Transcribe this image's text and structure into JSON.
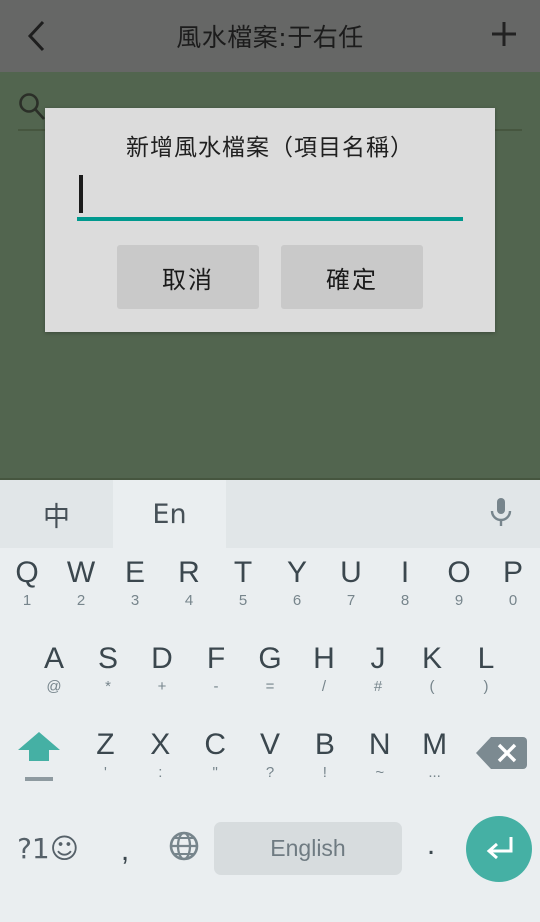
{
  "app": {
    "title": "風水檔案:于右任",
    "back_icon": "chevron-left-icon",
    "add_icon": "plus-icon",
    "search_icon": "search-icon",
    "appbar_color": "#666766",
    "content_color": "#52654f"
  },
  "dialog": {
    "title": "新增風水檔案（項目名稱）",
    "input_value": "",
    "input_placeholder": "",
    "underline_color": "#00998e",
    "background_color": "#dcdcdc",
    "buttons": [
      {
        "label": "取消",
        "name": "cancel-button"
      },
      {
        "label": "確定",
        "name": "confirm-button"
      }
    ]
  },
  "keyboard": {
    "accent_color": "#45b0a4",
    "background_color": "#eaeef0",
    "toolbar": {
      "tabs": [
        {
          "label": "中",
          "active": false
        },
        {
          "label": "En",
          "active": true
        }
      ],
      "mic_icon": "microphone-icon"
    },
    "row1": [
      {
        "main": "Q",
        "alt": "1"
      },
      {
        "main": "W",
        "alt": "2"
      },
      {
        "main": "E",
        "alt": "3"
      },
      {
        "main": "R",
        "alt": "4"
      },
      {
        "main": "T",
        "alt": "5"
      },
      {
        "main": "Y",
        "alt": "6"
      },
      {
        "main": "U",
        "alt": "7"
      },
      {
        "main": "I",
        "alt": "8"
      },
      {
        "main": "O",
        "alt": "9"
      },
      {
        "main": "P",
        "alt": "0"
      }
    ],
    "row2": [
      {
        "main": "A",
        "alt": "@"
      },
      {
        "main": "S",
        "alt": "*"
      },
      {
        "main": "D",
        "alt": "+"
      },
      {
        "main": "F",
        "alt": "-"
      },
      {
        "main": "G",
        "alt": "="
      },
      {
        "main": "H",
        "alt": "/"
      },
      {
        "main": "J",
        "alt": "#"
      },
      {
        "main": "K",
        "alt": "("
      },
      {
        "main": "L",
        "alt": ")"
      }
    ],
    "row3": {
      "shift_icon": "shift-arrow-icon",
      "letters": [
        {
          "main": "Z",
          "alt": "'"
        },
        {
          "main": "X",
          "alt": ":"
        },
        {
          "main": "C",
          "alt": "\""
        },
        {
          "main": "V",
          "alt": "?"
        },
        {
          "main": "B",
          "alt": "!"
        },
        {
          "main": "N",
          "alt": "~"
        },
        {
          "main": "M",
          "alt": "..."
        }
      ],
      "backspace_icon": "backspace-icon"
    },
    "row4": {
      "symbol_key": "?1☺",
      "comma": ",",
      "globe_icon": "globe-icon",
      "space_label": "English",
      "period": ".",
      "enter_icon": "enter-return-icon"
    }
  }
}
